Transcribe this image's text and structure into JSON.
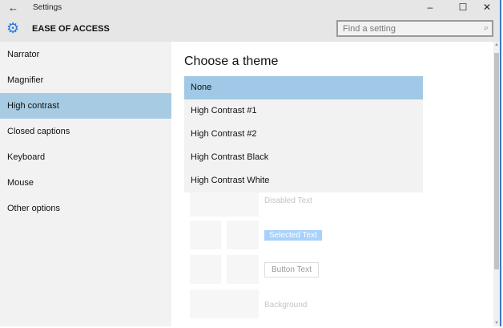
{
  "titlebar": {
    "title": "Settings",
    "back_icon": "back-arrow-icon"
  },
  "header": {
    "title": "EASE OF ACCESS",
    "search_placeholder": "Find a setting"
  },
  "sidebar": {
    "items": [
      {
        "label": "Narrator"
      },
      {
        "label": "Magnifier"
      },
      {
        "label": "High contrast",
        "selected": true
      },
      {
        "label": "Closed captions"
      },
      {
        "label": "Keyboard"
      },
      {
        "label": "Mouse"
      },
      {
        "label": "Other options"
      }
    ]
  },
  "main": {
    "heading": "Choose a theme",
    "options": [
      {
        "label": "None",
        "selected": true
      },
      {
        "label": "High Contrast #1"
      },
      {
        "label": "High Contrast #2"
      },
      {
        "label": "High Contrast Black"
      },
      {
        "label": "High Contrast White"
      }
    ],
    "preview": {
      "disabled": "Disabled Text",
      "selected": "Selected Text",
      "button": "Button Text",
      "background": "Background"
    }
  },
  "colors": {
    "accent": "#2a7ad4",
    "selection": "#a6cbe3"
  }
}
